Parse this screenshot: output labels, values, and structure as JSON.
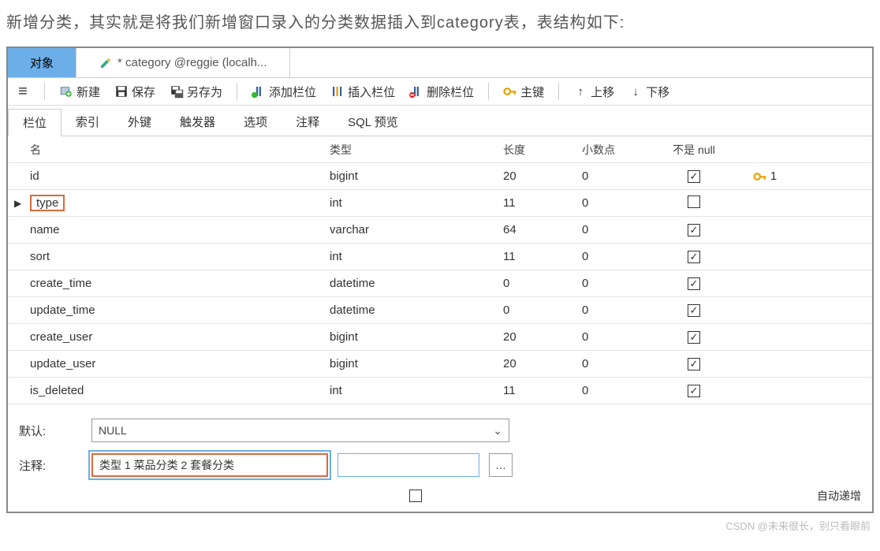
{
  "heading": "新增分类，其实就是将我们新增窗口录入的分类数据插入到category表，表结构如下:",
  "tabs": {
    "object": "对象",
    "file": "* category @reggie (localh..."
  },
  "toolbar": {
    "new": "新建",
    "save": "保存",
    "saveas": "另存为",
    "addcol": "添加栏位",
    "insertcol": "插入栏位",
    "deletecol": "删除栏位",
    "pk": "主键",
    "moveup": "上移",
    "movedown": "下移"
  },
  "subtabs": [
    "栏位",
    "索引",
    "外键",
    "触发器",
    "选项",
    "注释",
    "SQL 预览"
  ],
  "grid": {
    "headers": {
      "name": "名",
      "type": "类型",
      "length": "长度",
      "decimals": "小数点",
      "notnull": "不是 null"
    },
    "rows": [
      {
        "name": "id",
        "type": "bigint",
        "length": "20",
        "decimals": "0",
        "notnull": true,
        "pk": "1",
        "marker": "",
        "hl": false
      },
      {
        "name": "type",
        "type": "int",
        "length": "11",
        "decimals": "0",
        "notnull": false,
        "pk": "",
        "marker": "▶",
        "hl": true
      },
      {
        "name": "name",
        "type": "varchar",
        "length": "64",
        "decimals": "0",
        "notnull": true,
        "pk": "",
        "marker": "",
        "hl": false
      },
      {
        "name": "sort",
        "type": "int",
        "length": "11",
        "decimals": "0",
        "notnull": true,
        "pk": "",
        "marker": "",
        "hl": false
      },
      {
        "name": "create_time",
        "type": "datetime",
        "length": "0",
        "decimals": "0",
        "notnull": true,
        "pk": "",
        "marker": "",
        "hl": false
      },
      {
        "name": "update_time",
        "type": "datetime",
        "length": "0",
        "decimals": "0",
        "notnull": true,
        "pk": "",
        "marker": "",
        "hl": false
      },
      {
        "name": "create_user",
        "type": "bigint",
        "length": "20",
        "decimals": "0",
        "notnull": true,
        "pk": "",
        "marker": "",
        "hl": false
      },
      {
        "name": "update_user",
        "type": "bigint",
        "length": "20",
        "decimals": "0",
        "notnull": true,
        "pk": "",
        "marker": "",
        "hl": false
      },
      {
        "name": "is_deleted",
        "type": "int",
        "length": "11",
        "decimals": "0",
        "notnull": true,
        "pk": "",
        "marker": "",
        "hl": false
      }
    ]
  },
  "props": {
    "default_label": "默认:",
    "default_value": "NULL",
    "comment_label": "注释:",
    "comment_value": "类型   1 菜品分类 2 套餐分类",
    "autoinc_label": "自动递增"
  },
  "watermark": "CSDN @未来很长，别只看眼前"
}
